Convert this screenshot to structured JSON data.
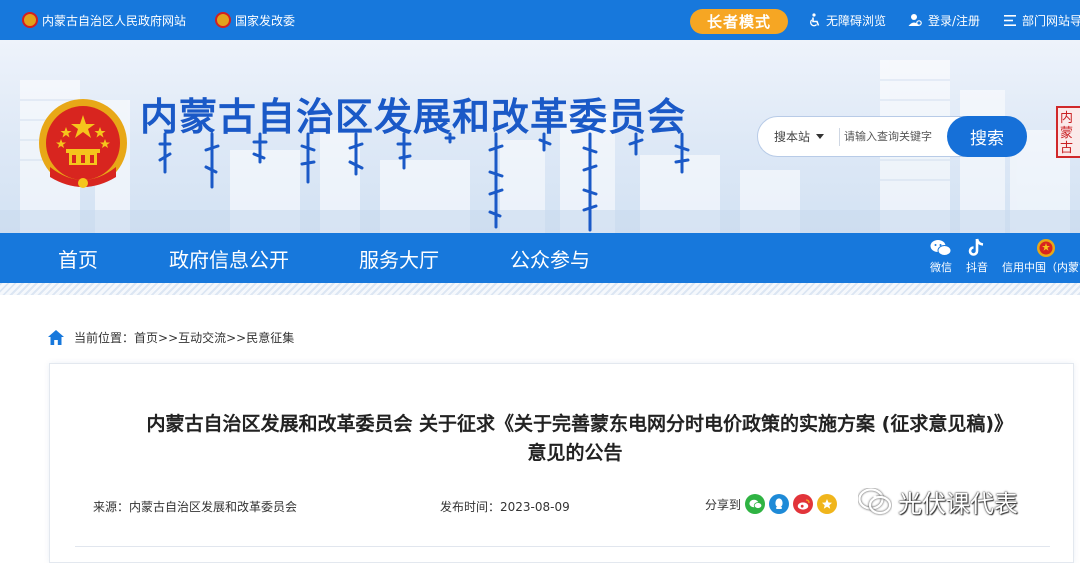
{
  "topbar": {
    "gov_portal": "内蒙古自治区人民政府网站",
    "ndrc": "国家发改委",
    "elder_mode": "长者模式",
    "accessibility": "无障碍浏览",
    "login": "登录/注册",
    "dept_sites": "部门网站导"
  },
  "header": {
    "site_title": "内蒙古自治区发展和改革委员会",
    "search": {
      "scope": "搜本站",
      "placeholder": "请输入查询关键字",
      "button": "搜索"
    },
    "seal_text": "内蒙古"
  },
  "nav": {
    "items": [
      {
        "label": "首页"
      },
      {
        "label": "政府信息公开"
      },
      {
        "label": "服务大厅"
      },
      {
        "label": "公众参与"
      }
    ],
    "social": [
      {
        "label": "微信"
      },
      {
        "label": "抖音"
      },
      {
        "label": "信用中国（内蒙古"
      }
    ]
  },
  "breadcrumb": {
    "prefix": "当前位置：",
    "path": "首页>>互动交流>>民意征集"
  },
  "article": {
    "title": "内蒙古自治区发展和改革委员会 关于征求《关于完善蒙东电网分时电价政策的实施方案 (征求意见稿)》意见的公告",
    "source": "来源：内蒙古自治区发展和改革委员会",
    "date": "发布时间：2023-08-09",
    "share_label": "分享到"
  },
  "watermark": "光伏课代表",
  "colors": {
    "primary_blue": "#1778dc",
    "title_blue": "#1a59c7",
    "elder_orange": "#f6a623",
    "search_blue": "#1670d8"
  },
  "icons": [
    "emblem-icon",
    "accessibility-icon",
    "user-icon",
    "menu-icon",
    "wechat-icon",
    "douyin-icon",
    "home-icon",
    "qq-icon",
    "weibo-icon",
    "qzone-icon"
  ]
}
